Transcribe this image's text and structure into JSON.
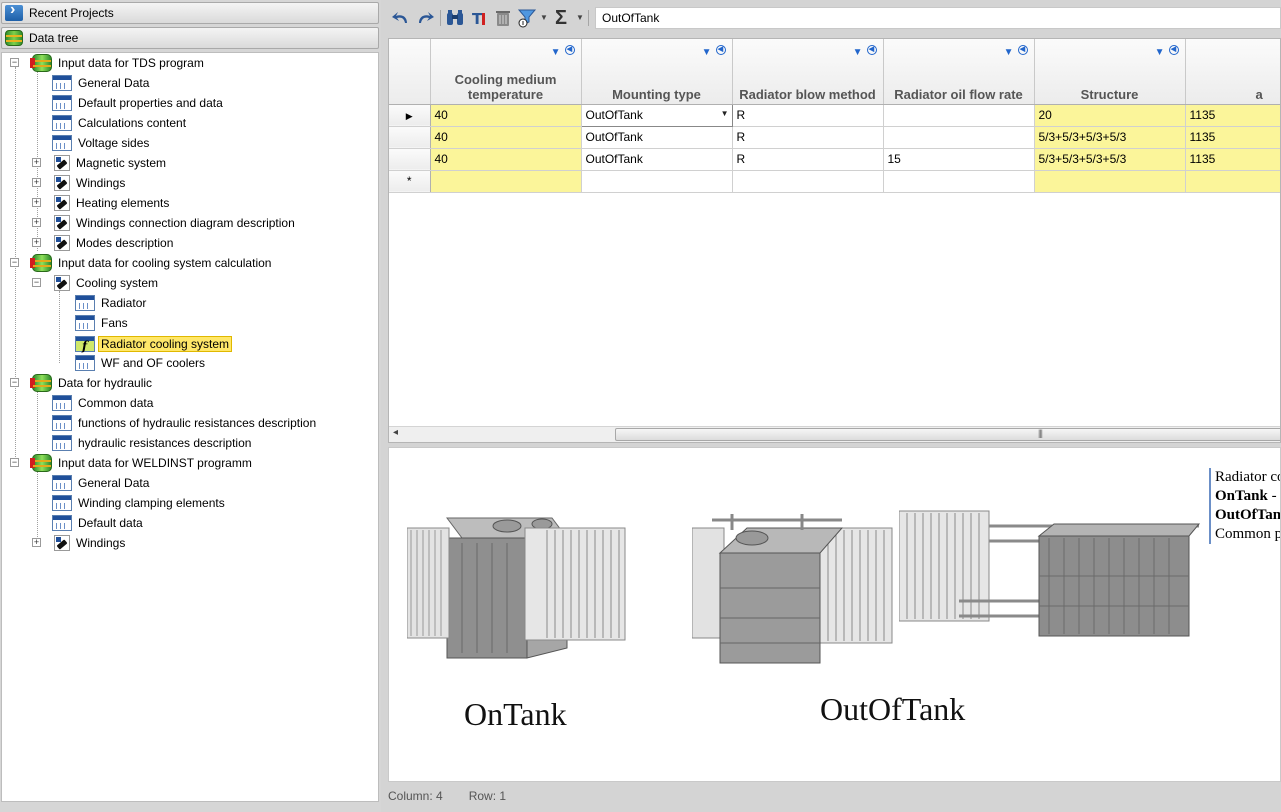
{
  "left_panel": {
    "recent_projects": "Recent Projects",
    "data_tree": "Data tree",
    "tree": [
      {
        "label": "Input data for TDS program",
        "icon": "database-icon"
      },
      {
        "label": "General Data",
        "icon": "table-icon"
      },
      {
        "label": "Default properties and data",
        "icon": "table-icon"
      },
      {
        "label": "Calculations content",
        "icon": "table-icon"
      },
      {
        "label": "Voltage sides",
        "icon": "table-icon"
      },
      {
        "label": "Magnetic system",
        "icon": "module-icon"
      },
      {
        "label": "Windings",
        "icon": "module-icon"
      },
      {
        "label": "Heating elements",
        "icon": "module-icon"
      },
      {
        "label": "Windings connection diagram description",
        "icon": "module-icon"
      },
      {
        "label": "Modes description",
        "icon": "module-icon"
      },
      {
        "label": "Input data for cooling system calculation",
        "icon": "database-icon"
      },
      {
        "label": "Cooling system",
        "icon": "module-icon"
      },
      {
        "label": "Radiator",
        "icon": "table-icon"
      },
      {
        "label": "Fans",
        "icon": "table-icon"
      },
      {
        "label": "Radiator cooling system",
        "icon": "function-table-icon"
      },
      {
        "label": "WF and OF coolers",
        "icon": "table-icon"
      },
      {
        "label": "Data for hydraulic",
        "icon": "database-icon"
      },
      {
        "label": "Common data",
        "icon": "table-icon"
      },
      {
        "label": "functions of hydraulic resistances description",
        "icon": "table-icon"
      },
      {
        "label": "hydraulic resistances description",
        "icon": "table-icon"
      },
      {
        "label": "Input data for WELDINST programm",
        "icon": "database-icon"
      },
      {
        "label": "General Data",
        "icon": "table-icon"
      },
      {
        "label": "Winding clamping elements",
        "icon": "table-icon"
      },
      {
        "label": "Default data",
        "icon": "table-icon"
      },
      {
        "label": "Windings",
        "icon": "module-icon"
      }
    ]
  },
  "toolbar": {
    "formula_value": "OutOfTank",
    "sigma": "Σ"
  },
  "grid": {
    "columns": [
      "Cooling medium temperature",
      "Mounting type",
      "Radiator blow method",
      "Radiator oil flow rate",
      "Structure",
      "a"
    ],
    "rows": [
      [
        "40",
        "OutOfTank",
        "R",
        "",
        "20",
        "1135"
      ],
      [
        "40",
        "OutOfTank",
        "R",
        "",
        "5/3+5/3+5/3+5/3",
        "1135"
      ],
      [
        "40",
        "OutOfTank",
        "R",
        "15",
        "5/3+5/3+5/3+5/3",
        "1135"
      ]
    ],
    "new_row_marker": "*"
  },
  "preview": {
    "caption_left": "OnTank",
    "caption_right": "OutOfTank",
    "desc_line1": "Radiator co",
    "desc_line2_bold": "OnTank",
    "desc_line2_rest": " -",
    "desc_line3_bold": "OutOfTan",
    "desc_line4": "Common p"
  },
  "status": {
    "column": "Column: 4",
    "row": "Row: 1"
  },
  "colors": {
    "selected_tree_item": "#ffe769",
    "yellow_cell": "#fbf59a",
    "accent_blue": "#2b5796"
  }
}
